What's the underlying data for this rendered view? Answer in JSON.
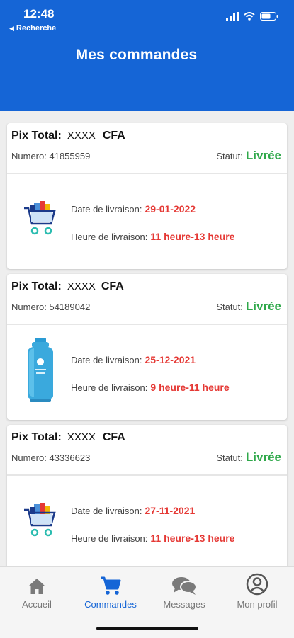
{
  "status_bar": {
    "time": "12:48",
    "back_label": "Recherche"
  },
  "header": {
    "title": "Mes commandes"
  },
  "labels": {
    "total": "Pix Total:",
    "numero": "Numero:",
    "statut": "Statut:",
    "date_livraison": "Date de livraison:",
    "heure_livraison": "Heure de livraison:"
  },
  "orders": [
    {
      "amount": "XXXX",
      "currency": "CFA",
      "numero": "41855959",
      "statut": "Livrée",
      "date": "29-01-2022",
      "heure": "11 heure-13 heure",
      "image": "shopping-cart-icon"
    },
    {
      "amount": "XXXX",
      "currency": "CFA",
      "numero": "54189042",
      "statut": "Livrée",
      "date": "25-12-2021",
      "heure": "9 heure-11 heure",
      "image": "gas-cylinder-icon"
    },
    {
      "amount": "XXXX",
      "currency": "CFA",
      "numero": "43336623",
      "statut": "Livrée",
      "date": "27-11-2021",
      "heure": "11 heure-13 heure",
      "image": "shopping-cart-icon"
    }
  ],
  "nav": {
    "items": [
      {
        "label": "Accueil",
        "icon": "home-icon"
      },
      {
        "label": "Commandes",
        "icon": "cart-icon",
        "active": true
      },
      {
        "label": "Messages",
        "icon": "chat-icon"
      },
      {
        "label": "Mon profil",
        "icon": "profile-icon"
      }
    ]
  },
  "colors": {
    "primary": "#1565d6",
    "status_green": "#2fa84a",
    "value_red": "#e53935"
  }
}
